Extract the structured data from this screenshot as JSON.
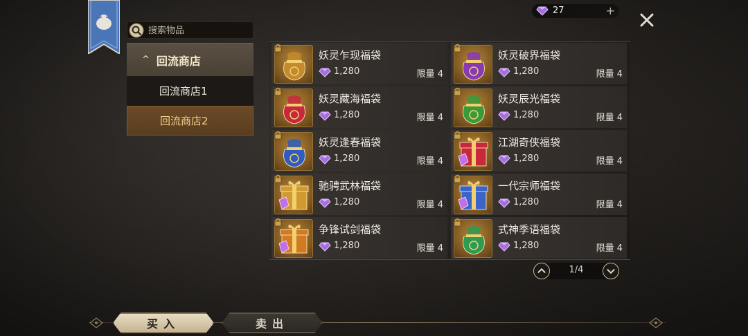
{
  "currency": {
    "amount": "27",
    "plus": "+"
  },
  "search": {
    "placeholder": "搜索物品"
  },
  "sidebar": {
    "header": {
      "caret": "^",
      "label": "回流商店"
    },
    "items": [
      {
        "label": "回流商店1"
      },
      {
        "label": "回流商店2"
      }
    ]
  },
  "items": [
    {
      "name": "妖灵乍现福袋",
      "price": "1,280",
      "limit": "限量 4",
      "icon": "gold-lucky-bag-icon",
      "color": "#c48a2e"
    },
    {
      "name": "妖灵破界福袋",
      "price": "1,280",
      "limit": "限量 4",
      "icon": "purple-lucky-bag-icon",
      "color": "#8a3ab0"
    },
    {
      "name": "妖灵藏海福袋",
      "price": "1,280",
      "limit": "限量 4",
      "icon": "red-lucky-bag-icon",
      "color": "#c8283e"
    },
    {
      "name": "妖灵辰光福袋",
      "price": "1,280",
      "limit": "限量 4",
      "icon": "green-lucky-bag-icon",
      "color": "#3a9a3a"
    },
    {
      "name": "妖灵逢春福袋",
      "price": "1,280",
      "limit": "限量 4",
      "icon": "blue-lucky-bag-icon",
      "color": "#2e5cc0"
    },
    {
      "name": "江湖奇侠福袋",
      "price": "1,280",
      "limit": "限量 4",
      "icon": "red-gift-box-icon",
      "color": "#c8283a"
    },
    {
      "name": "驰骋武林福袋",
      "price": "1,280",
      "limit": "限量 4",
      "icon": "gold-gift-box-icon",
      "color": "#d09a30"
    },
    {
      "name": "一代宗师福袋",
      "price": "1,280",
      "limit": "限量 4",
      "icon": "blue-gift-box-icon",
      "color": "#3a64c8"
    },
    {
      "name": "争锋试剑福袋",
      "price": "1,280",
      "limit": "限量 4",
      "icon": "orange-gift-box-icon",
      "color": "#d07a22"
    },
    {
      "name": "式神季语福袋",
      "price": "1,280",
      "limit": "限量 4",
      "icon": "green-lucky-bag-icon",
      "color": "#2e9a52"
    }
  ],
  "pagination": {
    "text": "1/4"
  },
  "tabs": {
    "buy": "买入",
    "sell": "卖出"
  },
  "colors": {
    "accent": "#f6cf8a",
    "gem": "#b27ae8"
  }
}
